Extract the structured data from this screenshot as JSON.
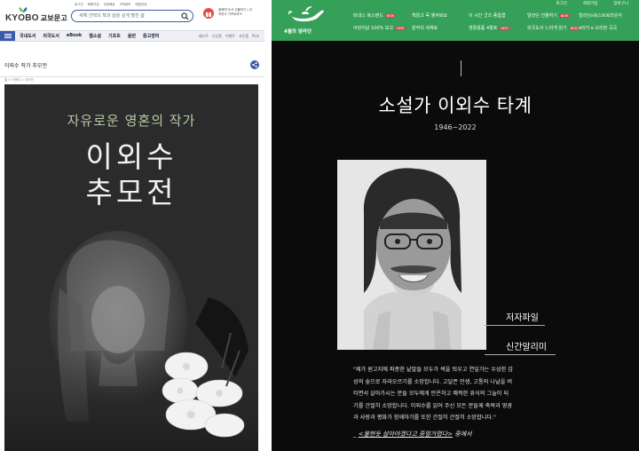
{
  "left": {
    "logo": {
      "text": "KYOBO",
      "korean": "교보문고"
    },
    "top_links": [
      "로그인",
      "회원가입",
      "주문배송",
      "고객센터",
      "매장안내"
    ],
    "search": {
      "placeholder": "새해 선택의 책과 삶을 깊게 펼친 봄"
    },
    "promo_text": "올해의 도서 선물하기 | 교보문고 기프트카드",
    "nav": {
      "items": [
        "국내도서",
        "외국도서",
        "eBook",
        "웹소설",
        "기프트",
        "음반",
        "중고장터"
      ],
      "right_items": [
        "베스트",
        "신상품",
        "이벤트",
        "사은품",
        "Pick"
      ]
    },
    "page_title": "이외수 작가 추모전",
    "breadcrumb": "홈 > 이벤트 > 추모전",
    "poster": {
      "subtitle": "자유로운 영혼의 작가",
      "title_line1": "이외수",
      "title_line2": "추모전"
    }
  },
  "right": {
    "brand": "4월의 앞라단",
    "util": [
      "로그인",
      "회원가입",
      "장바구니"
    ],
    "menu": [
      {
        "label": "따내스 북스탠드",
        "new": true
      },
      {
        "label": "책읽고 꼭 챙겨봐요",
        "new": false
      },
      {
        "label": "이 시간 굿즈 종합쿱",
        "new": false
      },
      {
        "label": "얼라딘 선물하기",
        "new": true
      },
      {
        "label": "얼라딘x북스트북라운지",
        "new": false
      },
      {
        "label": "어린이날 100% 보고",
        "new": true
      },
      {
        "label": "원작의 세계로",
        "new": false
      },
      {
        "label": "생활용품 4월호",
        "new": true
      },
      {
        "label": "외국도서 느리게 읽기",
        "new": true
      },
      {
        "label": "e티거 e 오리본 곡곡",
        "new": false
      }
    ],
    "new_badge": "NEW",
    "title": "소설가 이외수 타계",
    "years": "1946~2022",
    "links": [
      "저자파일",
      "신간알리미"
    ],
    "quote_lines": [
      "\"제가 원고지에 파종한 낱말들 모두가 싹을 틔우고 연잎가는 우성한 감",
      "성의 숲으로 자라오르기를 소망합니다. 고달픈 인생, 고통의 나날을 버",
      "티면서 살아가시는 분들 모두에게 안온하고 쾌적한 휴식의 그늘이 되",
      "기를 간절히 소망합니다. 이외수를 읽어 주신 모든 분들께 축복과 영광",
      "과 사랑과 평화가 함께하기를 또한 간절히 간절히 소망합니다.\""
    ],
    "source_prefix": "_ ",
    "source_title": "<불현듯 살아야겠다고 중얼거렸다>",
    "source_suffix": " 중에서"
  }
}
